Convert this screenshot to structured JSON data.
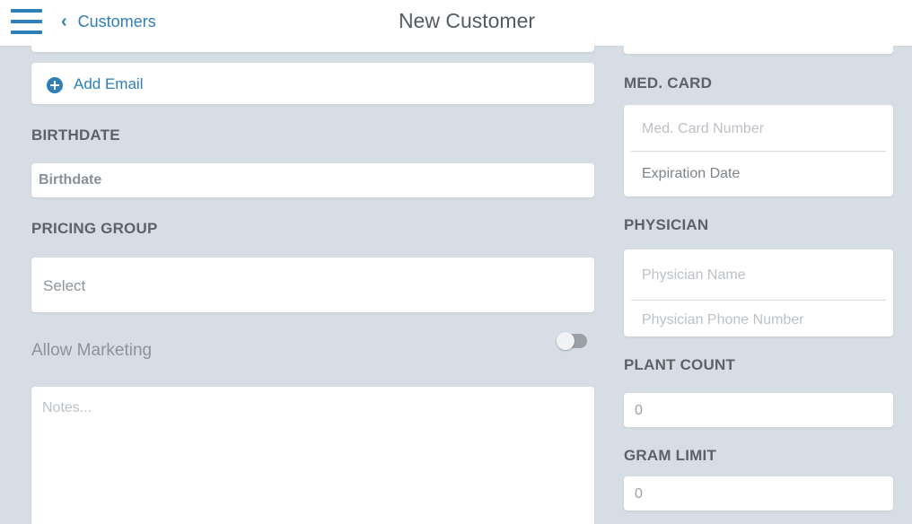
{
  "header": {
    "back_label": "Customers",
    "title": "New Customer"
  },
  "left": {
    "add_email_label": "Add Email",
    "birthdate": {
      "label": "BIRTHDATE",
      "value": "Birthdate"
    },
    "pricing_group": {
      "label": "PRICING GROUP",
      "value": "Select"
    },
    "allow_marketing": {
      "label": "Allow Marketing",
      "enabled": false
    },
    "notes": {
      "placeholder": "Notes..."
    }
  },
  "right": {
    "med_card": {
      "label": "MED. CARD",
      "number_placeholder": "Med. Card Number",
      "expiration_label": "Expiration Date"
    },
    "physician": {
      "label": "PHYSICIAN",
      "name_placeholder": "Physician Name",
      "phone_placeholder": "Physician Phone Number"
    },
    "plant_count": {
      "label": "PLANT COUNT",
      "value": "0"
    },
    "gram_limit": {
      "label": "GRAM LIMIT",
      "value": "0"
    }
  },
  "icons": {
    "menu": "hamburger-menu-icon",
    "back": "chevron-left-icon",
    "add": "plus-circle-icon"
  },
  "colors": {
    "accent": "#2f7fb6",
    "background": "#d6dde4"
  }
}
